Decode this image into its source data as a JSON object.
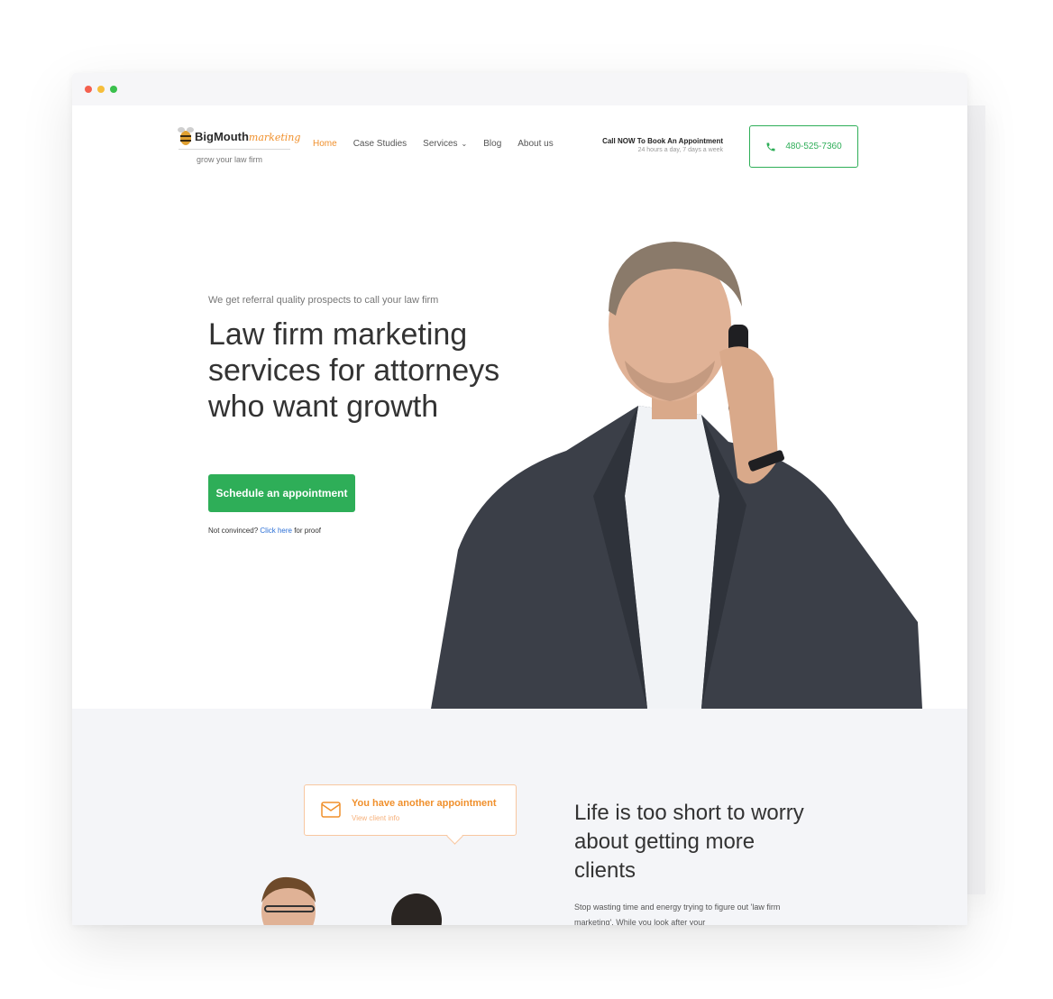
{
  "browser": {
    "dots": [
      "red",
      "yellow",
      "green"
    ]
  },
  "header": {
    "logo": {
      "brand": "BigMouth",
      "script": "marketing",
      "tagline": "grow your law firm"
    },
    "nav": [
      {
        "label": "Home",
        "active": true
      },
      {
        "label": "Case Studies",
        "active": false
      },
      {
        "label": "Services",
        "active": false,
        "has_dropdown": true
      },
      {
        "label": "Blog",
        "active": false
      },
      {
        "label": "About us",
        "active": false
      }
    ],
    "cta_title": "Call NOW To Book An Appointment",
    "cta_sub": "24 hours a day, 7 days a week",
    "phone": "480-525-7360",
    "phone_icon": "phone-icon"
  },
  "hero": {
    "kicker": "We get referral quality prospects to call your law firm",
    "title": "Law firm marketing services for attorneys who want growth",
    "button": "Schedule an appointment",
    "proof_prefix": "Not convinced?",
    "proof_link": "Click here",
    "proof_suffix": "for proof"
  },
  "lower": {
    "notification": {
      "title": "You have another appointment",
      "sub": "View client info",
      "icon": "envelope-icon"
    },
    "title": "Life is too short to worry about getting more clients",
    "body": "Stop wasting time and energy trying to figure out 'law firm marketing'. While you look after your"
  },
  "colors": {
    "accent_green": "#2eae58",
    "accent_orange": "#f0902c",
    "link_blue": "#2b6fd6",
    "section_bg": "#f4f5f8"
  }
}
